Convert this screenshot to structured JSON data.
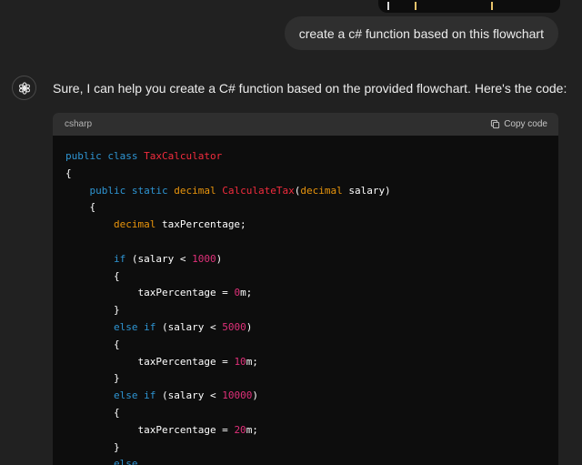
{
  "user_message": "create a c# function based on this flowchart",
  "assistant": {
    "intro": "Sure, I can help you create a C# function based on the provided flowchart. Here's the code:"
  },
  "code_block": {
    "language": "csharp",
    "copy_label": "Copy code",
    "lines": [
      [
        {
          "t": "public",
          "c": "kw"
        },
        {
          "t": " "
        },
        {
          "t": "class",
          "c": "kw"
        },
        {
          "t": " "
        },
        {
          "t": "TaxCalculator",
          "c": "ty"
        }
      ],
      [
        {
          "t": "{"
        }
      ],
      [
        {
          "t": "    "
        },
        {
          "t": "public",
          "c": "kw"
        },
        {
          "t": " "
        },
        {
          "t": "static",
          "c": "kw"
        },
        {
          "t": " "
        },
        {
          "t": "decimal",
          "c": "tp"
        },
        {
          "t": " "
        },
        {
          "t": "CalculateTax",
          "c": "ty"
        },
        {
          "t": "("
        },
        {
          "t": "decimal",
          "c": "tp"
        },
        {
          "t": " salary)"
        }
      ],
      [
        {
          "t": "    {"
        }
      ],
      [
        {
          "t": "        "
        },
        {
          "t": "decimal",
          "c": "tp"
        },
        {
          "t": " taxPercentage;"
        }
      ],
      [],
      [
        {
          "t": "        "
        },
        {
          "t": "if",
          "c": "kw"
        },
        {
          "t": " (salary < "
        },
        {
          "t": "1000",
          "c": "num"
        },
        {
          "t": ")"
        }
      ],
      [
        {
          "t": "        {"
        }
      ],
      [
        {
          "t": "            taxPercentage = "
        },
        {
          "t": "0",
          "c": "num"
        },
        {
          "t": "m;"
        }
      ],
      [
        {
          "t": "        }"
        }
      ],
      [
        {
          "t": "        "
        },
        {
          "t": "else",
          "c": "kw"
        },
        {
          "t": " "
        },
        {
          "t": "if",
          "c": "kw"
        },
        {
          "t": " (salary < "
        },
        {
          "t": "5000",
          "c": "num"
        },
        {
          "t": ")"
        }
      ],
      [
        {
          "t": "        {"
        }
      ],
      [
        {
          "t": "            taxPercentage = "
        },
        {
          "t": "10",
          "c": "num"
        },
        {
          "t": "m;"
        }
      ],
      [
        {
          "t": "        }"
        }
      ],
      [
        {
          "t": "        "
        },
        {
          "t": "else",
          "c": "kw"
        },
        {
          "t": " "
        },
        {
          "t": "if",
          "c": "kw"
        },
        {
          "t": " (salary < "
        },
        {
          "t": "10000",
          "c": "num"
        },
        {
          "t": ")"
        }
      ],
      [
        {
          "t": "        {"
        }
      ],
      [
        {
          "t": "            taxPercentage = "
        },
        {
          "t": "20",
          "c": "num"
        },
        {
          "t": "m;"
        }
      ],
      [
        {
          "t": "        }"
        }
      ],
      [
        {
          "t": "        "
        },
        {
          "t": "else",
          "c": "kw"
        }
      ]
    ]
  },
  "colors": {
    "background": "#212121",
    "bubble": "#2f2f2f",
    "code_bg": "#0d0d0d",
    "keyword": "#2e95d3",
    "type_name": "#f22c3d",
    "primitive": "#e9950c",
    "number": "#df3079"
  },
  "icons": {
    "avatar": "openai-logo-icon",
    "copy": "copy-icon"
  }
}
